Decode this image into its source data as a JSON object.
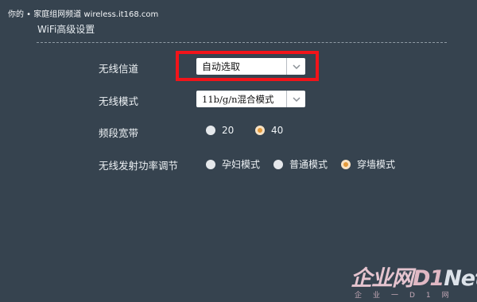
{
  "watermark_top": "你的 • 家庭组网频道 wireless.it168.com",
  "section": {
    "title": "WiFi高级设置"
  },
  "channel": {
    "label": "无线信道",
    "value": "自动选取"
  },
  "mode": {
    "label": "无线模式",
    "value": "11b/g/n混合模式"
  },
  "bandwidth": {
    "label": "频段宽带",
    "options": [
      {
        "label": "20",
        "checked": false
      },
      {
        "label": "40",
        "checked": true
      }
    ]
  },
  "power": {
    "label": "无线发射功率调节",
    "options": [
      {
        "label": "孕妇模式",
        "checked": false
      },
      {
        "label": "普通模式",
        "checked": false
      },
      {
        "label": "穿墙模式",
        "checked": true
      }
    ]
  },
  "logo": {
    "cn": "企业网",
    "d1": "D1",
    "net": "Net",
    "sub": "企业一D1网"
  },
  "colors": {
    "background": "#36434f",
    "highlight": "#f2141a",
    "radio_checked": "#e49a3b"
  },
  "icons": {
    "select_arrow": "chevron-down-icon"
  }
}
